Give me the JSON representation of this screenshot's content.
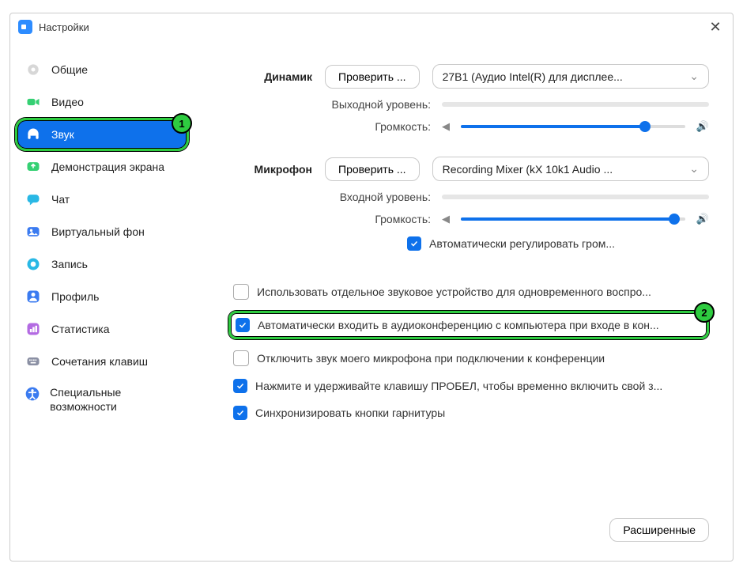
{
  "window": {
    "title": "Настройки"
  },
  "sidebar": {
    "items": [
      {
        "label": "Общие"
      },
      {
        "label": "Видео"
      },
      {
        "label": "Звук"
      },
      {
        "label": "Демонстрация экрана"
      },
      {
        "label": "Чат"
      },
      {
        "label": "Виртуальный фон"
      },
      {
        "label": "Запись"
      },
      {
        "label": "Профиль"
      },
      {
        "label": "Статистика"
      },
      {
        "label": "Сочетания клавиш"
      },
      {
        "label": "Специальные возможности"
      }
    ]
  },
  "badges": {
    "one": "1",
    "two": "2"
  },
  "audio": {
    "speaker_label": "Динамик",
    "test_btn": "Проверить ...",
    "speaker_device": "27B1 (Аудио Intel(R) для дисплее...",
    "output_level_label": "Выходной уровень:",
    "volume_label": "Громкость:",
    "mic_label": "Микрофон",
    "mic_test_btn": "Проверить ...",
    "mic_device": "Recording Mixer (kX 10k1 Audio ...",
    "input_level_label": "Входной уровень:",
    "auto_adjust": "Автоматически регулировать гром..."
  },
  "options": {
    "separate_device": "Использовать отдельное звуковое устройство для одновременного воспро...",
    "auto_join_audio": "Автоматически входить в аудиоконференцию с компьютера при входе в кон...",
    "mute_mic_on_join": "Отключить звук моего микрофона при подключении к конференции",
    "push_to_talk": "Нажмите и удерживайте клавишу ПРОБЕЛ, чтобы временно включить свой з...",
    "sync_headset": "Синхронизировать кнопки гарнитуры"
  },
  "footer": {
    "advanced": "Расширенные"
  }
}
